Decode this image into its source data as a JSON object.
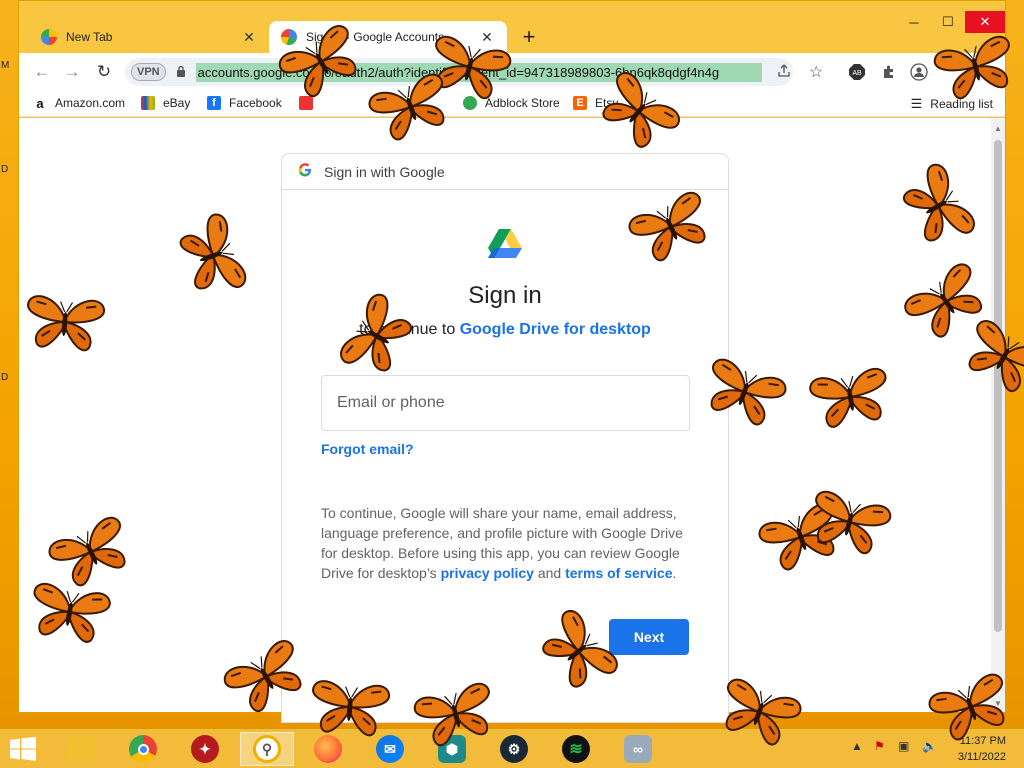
{
  "desktop_letters": [
    "M",
    "D",
    "D"
  ],
  "browser": {
    "tabs": [
      {
        "label": "New Tab",
        "close": "✕"
      },
      {
        "label": "Sign in - Google Accounts",
        "close": "✕"
      }
    ],
    "new_tab": "+",
    "window_controls": {
      "minimize": "─",
      "maximize": "☐",
      "close": "✕"
    },
    "nav": {
      "back": "←",
      "forward": "→",
      "reload": "↻"
    },
    "vpn_badge": "VPN",
    "url": "accounts.google.com/o/oauth2/auth?identifier&client_id=947318989803-6bn6qk8qdgf4n4g",
    "bookmarks": [
      "Amazon.com",
      "eBay",
      "Facebook",
      "",
      "Adblock Store",
      "Etsy"
    ],
    "reading_list": "Reading list"
  },
  "signin": {
    "header": "Sign in with Google",
    "title": "Sign in",
    "subtitle_prefix": "to continue to ",
    "app_name": "Google Drive for desktop",
    "email_placeholder": "Email or phone",
    "forgot_email": "Forgot email?",
    "consent_text_1": "To continue, Google will share your name, email address, language preference, and profile picture with Google Drive for desktop. Before using this app, you can review Google Drive for desktop’s ",
    "privacy_policy": "privacy policy",
    "and": " and ",
    "terms": "terms of service",
    "period": ".",
    "next_button": "Next"
  },
  "taskbar": {
    "apps": [
      "File Explorer",
      "Chrome",
      "Red app",
      "Locked app",
      "Firefox",
      "Thunderbird",
      "Shield app",
      "Steam",
      "Spotify",
      "Link app"
    ],
    "time": "11:37 PM",
    "date": "3/11/2022"
  },
  "colors": {
    "accent": "#1a73e8",
    "desktop": "#f4a300",
    "butterfly_orange": "#e8740c"
  }
}
